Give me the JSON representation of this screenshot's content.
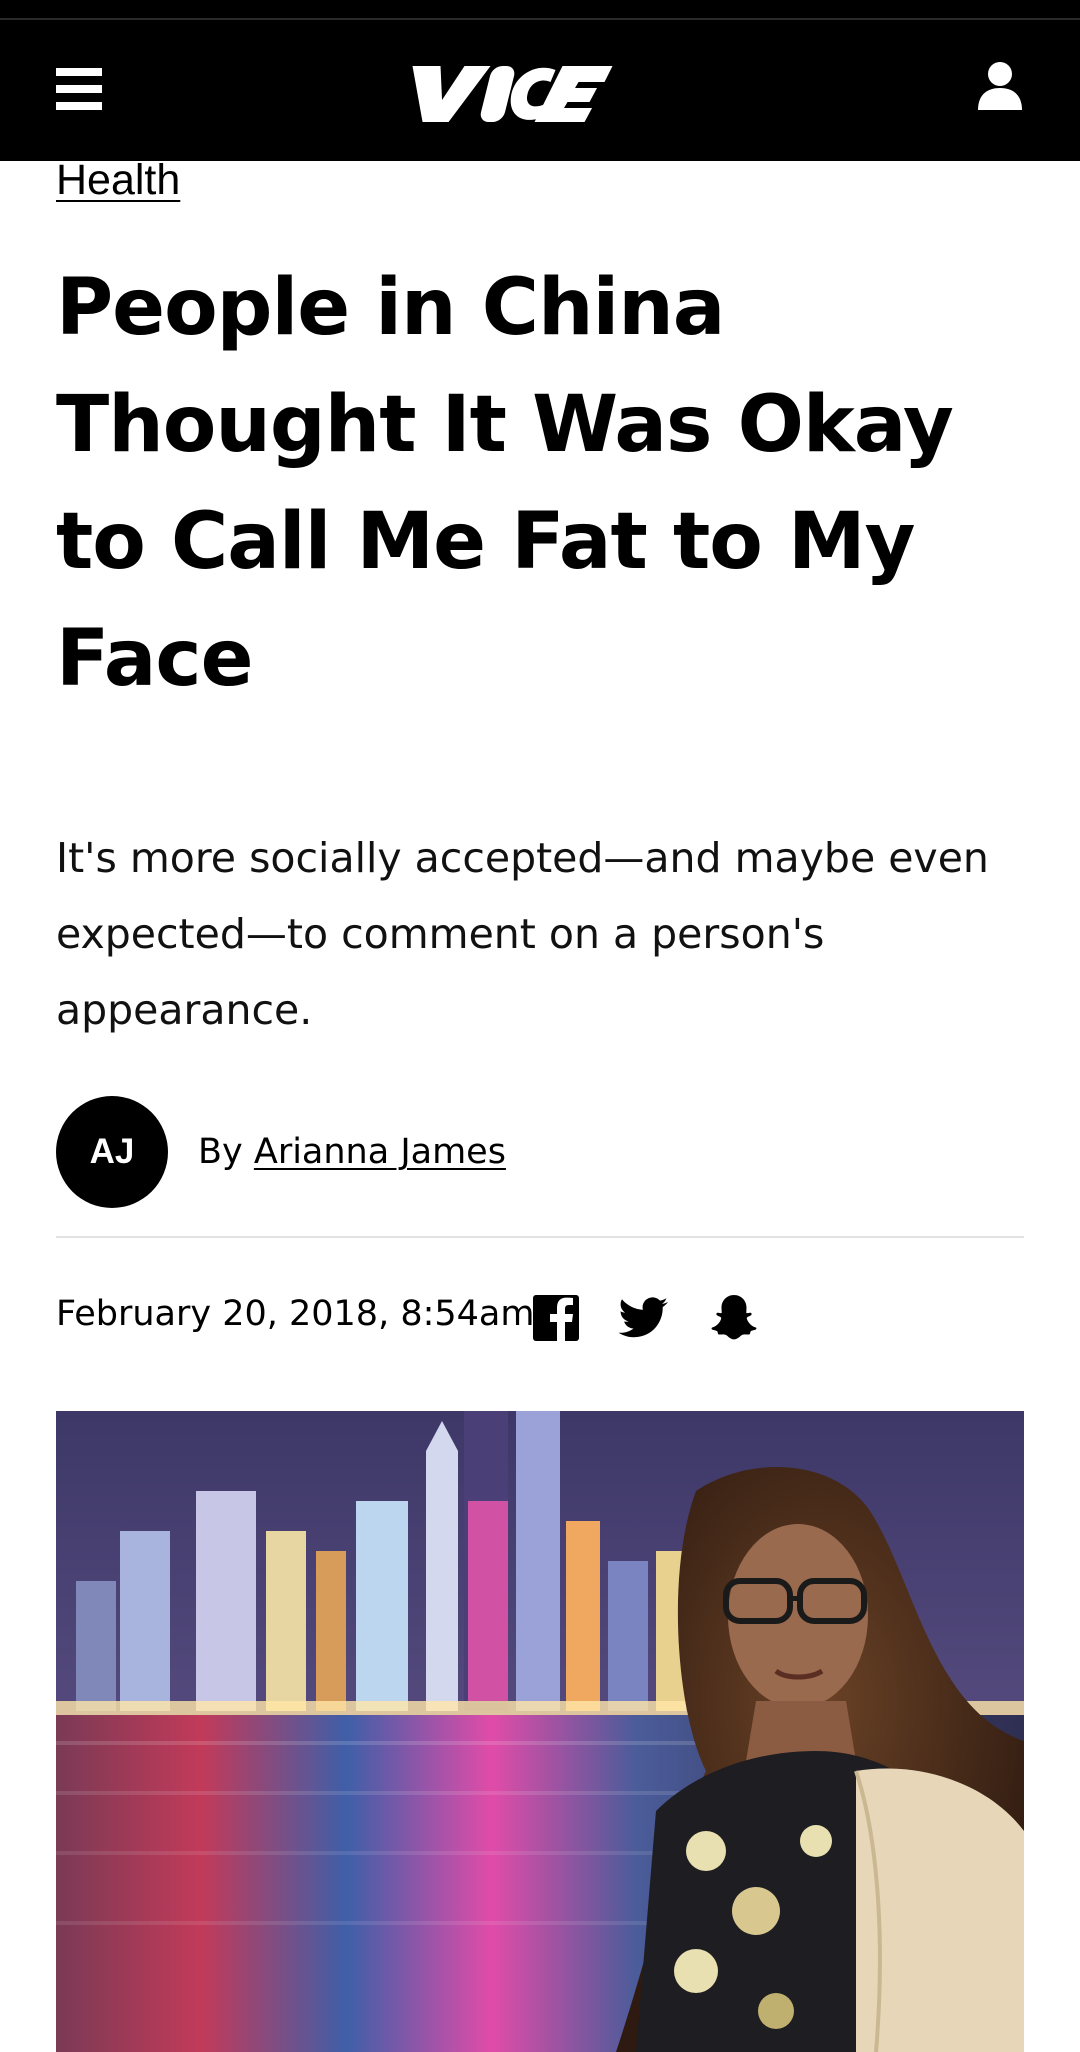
{
  "header": {
    "brand": "VICE",
    "menu_icon": "hamburger-menu-icon",
    "user_icon": "user-account-icon",
    "colors": {
      "bar": "#000000",
      "foreground": "#ffffff"
    }
  },
  "article": {
    "category": "Health",
    "headline": "People in China Thought It Was Okay to Call Me Fat to My Face",
    "dek": "It's more socially accepted—and maybe even expected—to comment on a person's appearance.",
    "author": {
      "initials": "AJ",
      "by_label": "By",
      "name": "Arianna James"
    },
    "timestamp": "February 20, 2018, 8:54am",
    "share": [
      {
        "network": "Facebook",
        "icon": "facebook-icon"
      },
      {
        "network": "Twitter",
        "icon": "twitter-icon"
      },
      {
        "network": "Snapchat",
        "icon": "snapchat-icon"
      }
    ],
    "hero_image": {
      "subject": "woman with glasses in front of a night city skyline across a river"
    }
  }
}
